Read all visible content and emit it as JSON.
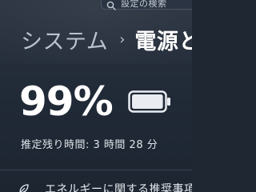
{
  "search": {
    "placeholder": "設定の検索",
    "icon": "search-icon"
  },
  "breadcrumb": {
    "parent": "システム",
    "separator": "›",
    "current": "電源とバ"
  },
  "battery": {
    "percent_text": "99%",
    "level": 0.99,
    "remaining_text": "推定残り時間: 3 時間 28 分",
    "icon": "battery-icon"
  },
  "recommendation": {
    "label": "エネルギーに関する推奨事項",
    "icon": "leaf-icon"
  },
  "colors": {
    "background": "#1f2733",
    "text_primary": "#ffffff",
    "text_secondary": "#b9c2cf"
  }
}
